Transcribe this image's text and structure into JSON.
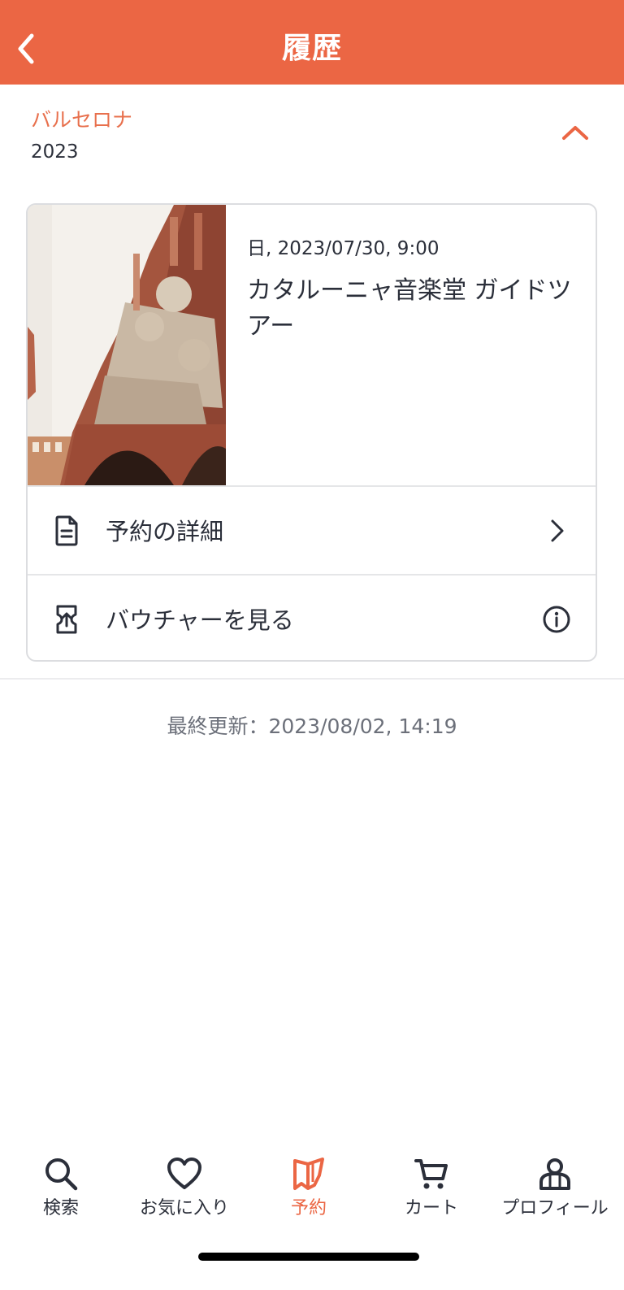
{
  "header": {
    "title": "履歴",
    "back_icon": "chevron-left-icon"
  },
  "section": {
    "city": "バルセロナ",
    "year": "2023",
    "toggle_icon": "chevron-up-icon"
  },
  "booking": {
    "date": "日, 2023/07/30, 9:00",
    "title": "カタルーニャ音楽堂 ガイドツアー",
    "image_icon": "building-photo",
    "rows": [
      {
        "label": "予約の詳細",
        "icon": "document-icon",
        "trail_icon": "chevron-right-icon"
      },
      {
        "label": "バウチャーを見る",
        "icon": "ticket-icon",
        "trail_icon": "info-icon"
      }
    ]
  },
  "last_updated": "最終更新：2023/08/02, 14:19",
  "tabs": [
    {
      "label": "検索",
      "icon": "search-icon",
      "active": false
    },
    {
      "label": "お気に入り",
      "icon": "heart-icon",
      "active": false
    },
    {
      "label": "予約",
      "icon": "booking-icon",
      "active": true
    },
    {
      "label": "カート",
      "icon": "cart-icon",
      "active": false
    },
    {
      "label": "プロフィール",
      "icon": "profile-icon",
      "active": false
    }
  ],
  "colors": {
    "accent": "#eb6644",
    "text": "#2b2f3a",
    "muted": "#6c707a"
  }
}
